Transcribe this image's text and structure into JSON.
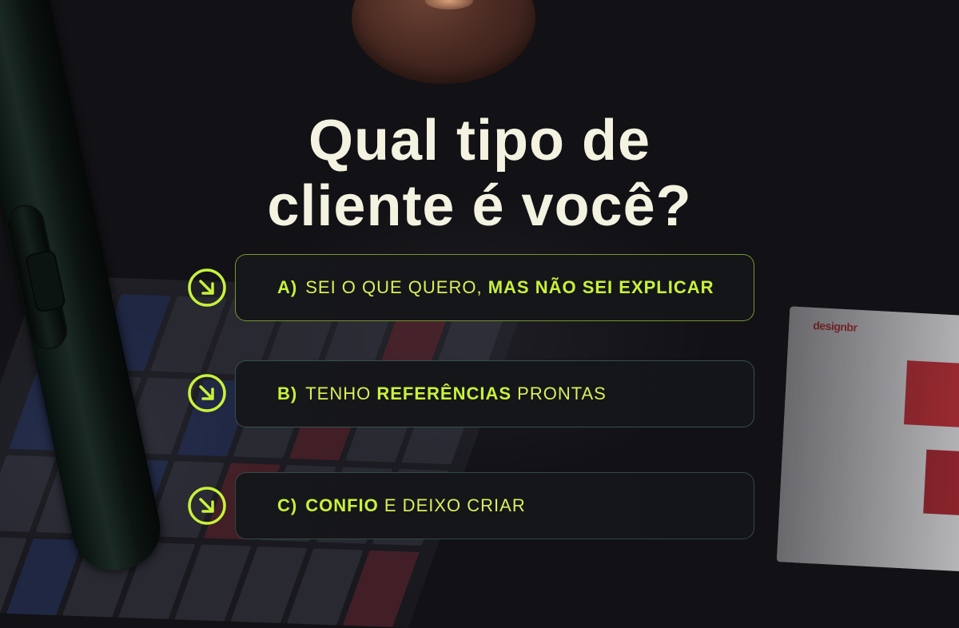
{
  "headline": {
    "line1": "Qual tipo de",
    "line2": "cliente é você?"
  },
  "options": [
    {
      "letter": "A)",
      "parts": [
        "SEI O QUE QUERO, ",
        "MAS NÃO SEI EXPLICAR"
      ]
    },
    {
      "letter": "B)",
      "parts": [
        "TENHO ",
        "REFERÊNCIAS",
        " PRONTAS"
      ]
    },
    {
      "letter": "C)",
      "parts": [
        "CONFIO",
        " E DEIXO CRIAR"
      ]
    }
  ],
  "background": {
    "brand_text": "design",
    "brand_suffix": "br"
  },
  "icons": {
    "option_icon": "arrow-down-right-circle-icon"
  },
  "colors": {
    "accent": "#c8f23a",
    "headline": "#f4f2e0",
    "background": "#121115"
  }
}
